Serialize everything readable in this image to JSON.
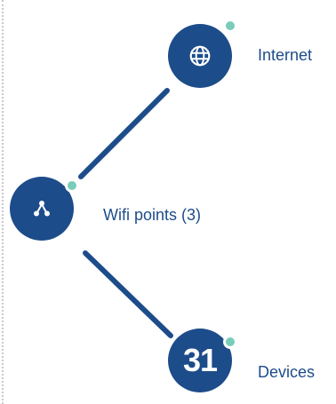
{
  "topology": {
    "internet": {
      "label": "Internet",
      "icon": "globe-icon"
    },
    "wifi_points": {
      "label": "Wifi points (3)",
      "icon": "network-nodes-icon"
    },
    "devices": {
      "count": "31",
      "label": "Devices"
    }
  },
  "colors": {
    "node": "#1d4c8a",
    "status": "#79cdb8",
    "connector": "#1d4c8a"
  }
}
